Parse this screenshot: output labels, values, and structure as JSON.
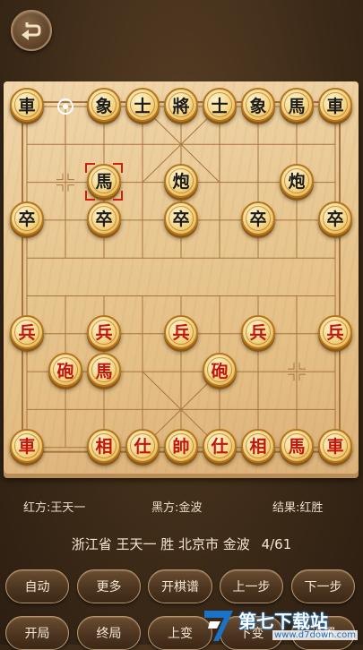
{
  "board": {
    "black_pieces": [
      {
        "label": "車",
        "col": 0,
        "row": 0
      },
      {
        "label": "象",
        "col": 2,
        "row": 0
      },
      {
        "label": "士",
        "col": 3,
        "row": 0
      },
      {
        "label": "將",
        "col": 4,
        "row": 0
      },
      {
        "label": "士",
        "col": 5,
        "row": 0
      },
      {
        "label": "象",
        "col": 6,
        "row": 0
      },
      {
        "label": "馬",
        "col": 7,
        "row": 0
      },
      {
        "label": "車",
        "col": 8,
        "row": 0
      },
      {
        "label": "馬",
        "col": 2,
        "row": 2
      },
      {
        "label": "炮",
        "col": 4,
        "row": 2
      },
      {
        "label": "炮",
        "col": 7,
        "row": 2
      },
      {
        "label": "卒",
        "col": 0,
        "row": 3
      },
      {
        "label": "卒",
        "col": 2,
        "row": 3
      },
      {
        "label": "卒",
        "col": 4,
        "row": 3
      },
      {
        "label": "卒",
        "col": 6,
        "row": 3
      },
      {
        "label": "卒",
        "col": 8,
        "row": 3
      }
    ],
    "red_pieces": [
      {
        "label": "兵",
        "col": 0,
        "row": 6
      },
      {
        "label": "兵",
        "col": 2,
        "row": 6
      },
      {
        "label": "兵",
        "col": 4,
        "row": 6
      },
      {
        "label": "兵",
        "col": 6,
        "row": 6
      },
      {
        "label": "兵",
        "col": 8,
        "row": 6
      },
      {
        "label": "砲",
        "col": 1,
        "row": 7
      },
      {
        "label": "馬",
        "col": 2,
        "row": 7
      },
      {
        "label": "砲",
        "col": 5,
        "row": 7
      },
      {
        "label": "車",
        "col": 0,
        "row": 9
      },
      {
        "label": "相",
        "col": 2,
        "row": 9
      },
      {
        "label": "仕",
        "col": 3,
        "row": 9
      },
      {
        "label": "帥",
        "col": 4,
        "row": 9
      },
      {
        "label": "仕",
        "col": 5,
        "row": 9
      },
      {
        "label": "相",
        "col": 6,
        "row": 9
      },
      {
        "label": "馬",
        "col": 7,
        "row": 9
      },
      {
        "label": "車",
        "col": 8,
        "row": 9
      }
    ],
    "last_move": {
      "from": {
        "col": 1,
        "row": 0
      },
      "to": {
        "col": 2,
        "row": 2
      }
    }
  },
  "info": {
    "red_player": "红方:王天一",
    "black_player": "黑方:金波",
    "result": "结果:红胜",
    "game_title": "浙江省 王天一 胜 北京市 金波",
    "move_progress": "4/61"
  },
  "controls": {
    "row1": [
      "自动",
      "更多",
      "开棋谱",
      "上一步",
      "下一步"
    ],
    "row2": [
      "开局",
      "终局",
      "上变",
      "下变",
      "设置"
    ]
  },
  "watermark": {
    "title": "第七下载站",
    "url": "www.d7down.com"
  },
  "colors": {
    "red_piece_text": "#c1140e",
    "black_piece_text": "#1b1b1b",
    "selection": "#d21f0c"
  }
}
